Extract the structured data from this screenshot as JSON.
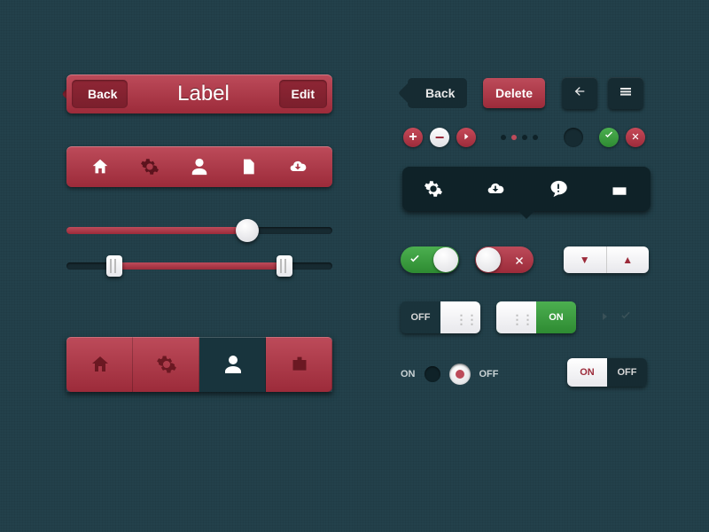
{
  "colors": {
    "accent": "#b13d4c",
    "dark": "#18343d",
    "green": "#3e9a44"
  },
  "navbar": {
    "back": "Back",
    "title": "Label",
    "edit": "Edit"
  },
  "toolbar": {
    "items": [
      "home",
      "gear",
      "user",
      "document",
      "cloud-download"
    ],
    "selected": 1
  },
  "sliders": [
    {
      "value": 68,
      "min": 0,
      "max": 100,
      "style": "round"
    },
    {
      "value_low": 18,
      "value_high": 82,
      "min": 0,
      "max": 100,
      "style": "range-square"
    }
  ],
  "tabbar": {
    "items": [
      "home",
      "gear",
      "user",
      "id-card"
    ],
    "selected": 2
  },
  "right": {
    "back": "Back",
    "delete": "Delete",
    "circles": [
      "plus",
      "minus",
      "chevron-right"
    ],
    "page_dots": {
      "count": 4,
      "active": 1
    },
    "status": [
      "check",
      "close"
    ],
    "tooltip_items": [
      "gear",
      "cloud-download",
      "chat-alert",
      "calendar"
    ],
    "switch_a": {
      "state": "on",
      "icon": "check"
    },
    "switch_b": {
      "state": "off",
      "icon": "close"
    },
    "stepper": {
      "down": "▼",
      "up": "▲"
    },
    "sqtoggle_off": {
      "label": "OFF"
    },
    "sqtoggle_on": {
      "label": "ON"
    },
    "chevrons": [
      "chevron-right",
      "check"
    ],
    "radio": {
      "on": "ON",
      "off": "OFF",
      "selected": 1
    },
    "segmented": {
      "on": "ON",
      "off": "OFF",
      "selected": 0
    }
  }
}
